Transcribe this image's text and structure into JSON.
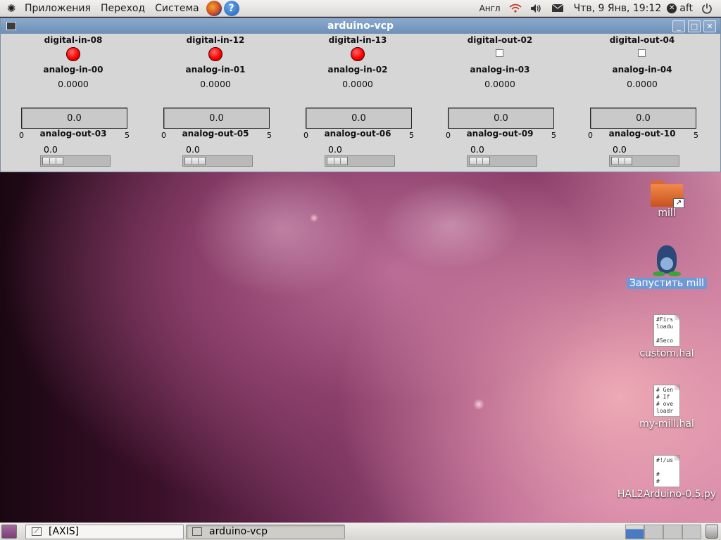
{
  "top_panel": {
    "menus": [
      "Приложения",
      "Переход",
      "Система"
    ],
    "keyboard_layout": "Англ",
    "clock": "Чтв, 9 Янв, 19:12",
    "user": "aft",
    "icons": {
      "logo": "ubuntu-logo-icon",
      "firefox": "firefox-icon",
      "help": "help-icon",
      "network": "wifi-icon",
      "volume": "volume-icon",
      "mail": "mail-icon",
      "power": "power-icon"
    }
  },
  "window": {
    "title": "arduino-vcp",
    "columns": [
      {
        "digital_label": "digital-in-08",
        "digital_type": "led",
        "analog_in_label": "analog-in-00",
        "analog_in_value": "0.0000",
        "bar_value": "0.0",
        "bar_fill": 0,
        "scale_min": "0",
        "scale_max": "5",
        "analog_out_label": "analog-out-03",
        "slider_value": "0.0",
        "slider_level": 0
      },
      {
        "digital_label": "digital-in-12",
        "digital_type": "led",
        "analog_in_label": "analog-in-01",
        "analog_in_value": "0.0000",
        "bar_value": "0.0",
        "bar_fill": 0,
        "scale_min": "0",
        "scale_max": "5",
        "analog_out_label": "analog-out-05",
        "slider_value": "0.0",
        "slider_level": 0
      },
      {
        "digital_label": "digital-in-13",
        "digital_type": "led",
        "analog_in_label": "analog-in-02",
        "analog_in_value": "0.0000",
        "bar_value": "0.0",
        "bar_fill": 0,
        "scale_min": "0",
        "scale_max": "5",
        "analog_out_label": "analog-out-06",
        "slider_value": "0.0",
        "slider_level": 0
      },
      {
        "digital_label": "digital-out-02",
        "digital_type": "checkbox",
        "analog_in_label": "analog-in-03",
        "analog_in_value": "0.0000",
        "bar_value": "0.0",
        "bar_fill": 0,
        "scale_min": "0",
        "scale_max": "5",
        "analog_out_label": "analog-out-09",
        "slider_value": "0.0",
        "slider_level": 0
      },
      {
        "digital_label": "digital-out-04",
        "digital_type": "checkbox",
        "analog_in_label": "analog-in-04",
        "analog_in_value": "0.0000",
        "bar_value": "0.0",
        "bar_fill": 0,
        "scale_min": "0",
        "scale_max": "5",
        "analog_out_label": "analog-out-10",
        "slider_value": "0.0",
        "slider_level": 0
      }
    ],
    "led_color": "#ff0000"
  },
  "desktop": {
    "icons": [
      {
        "label": "mill",
        "type": "folder",
        "selected": false
      },
      {
        "label": "Запустить mill",
        "type": "launcher",
        "selected": true
      },
      {
        "label": "custom.hal",
        "type": "text",
        "preview": "#Firs\nloadu\n\n#Seco",
        "selected": false
      },
      {
        "label": "my-mill.hal",
        "type": "text",
        "preview": "# Gen\n# If\n# ove\nloadr",
        "selected": false
      },
      {
        "label": "HAL2Arduino-0.5.py",
        "type": "text",
        "preview": "#!/us\n\n#\n#",
        "selected": false
      }
    ]
  },
  "bottom_panel": {
    "tasks": [
      {
        "label": "[AXIS]",
        "active": false
      },
      {
        "label": "arduino-vcp",
        "active": true
      }
    ],
    "workspace_count": 4,
    "active_workspace": 1
  }
}
